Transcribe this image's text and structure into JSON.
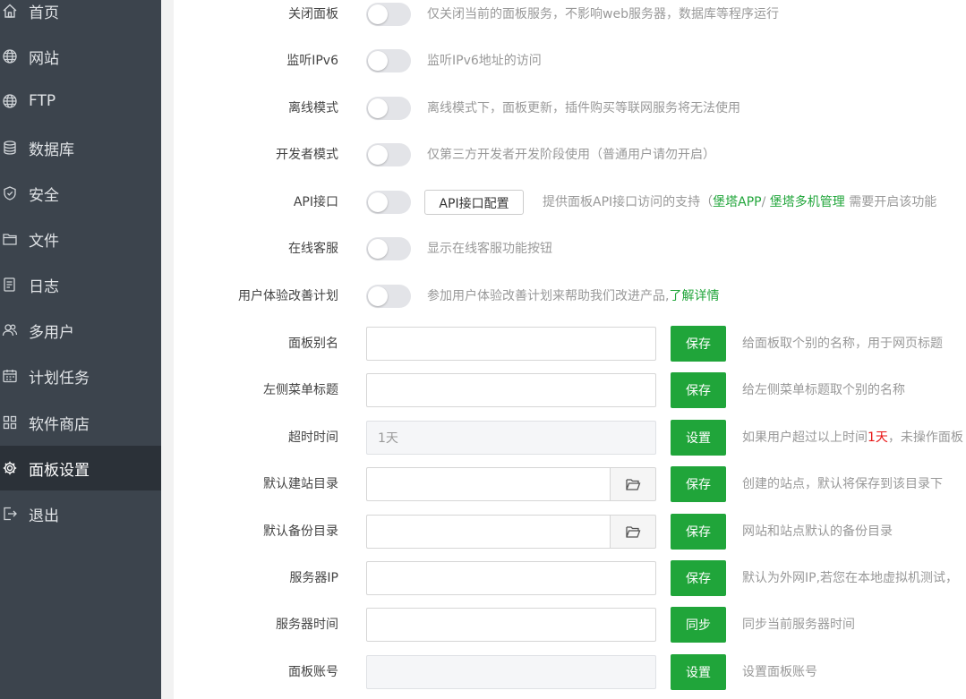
{
  "sidebar": {
    "items": [
      {
        "label": "首页",
        "icon": "home-icon"
      },
      {
        "label": "网站",
        "icon": "globe-icon"
      },
      {
        "label": "FTP",
        "icon": "ftp-globe-icon"
      },
      {
        "label": "数据库",
        "icon": "database-icon"
      },
      {
        "label": "安全",
        "icon": "shield-icon"
      },
      {
        "label": "文件",
        "icon": "folder-icon"
      },
      {
        "label": "日志",
        "icon": "log-icon"
      },
      {
        "label": "多用户",
        "icon": "users-icon"
      },
      {
        "label": "计划任务",
        "icon": "calendar-icon"
      },
      {
        "label": "软件商店",
        "icon": "grid-icon"
      },
      {
        "label": "面板设置",
        "icon": "gear-icon",
        "active": true
      },
      {
        "label": "退出",
        "icon": "logout-icon"
      }
    ]
  },
  "settings": {
    "close_panel": {
      "label": "关闭面板",
      "desc": "仅关闭当前的面板服务，不影响web服务器，数据库等程序运行"
    },
    "ipv6": {
      "label": "监听IPv6",
      "desc": "监听IPv6地址的访问"
    },
    "offline": {
      "label": "离线模式",
      "desc": "离线模式下，面板更新，插件购买等联网服务将无法使用"
    },
    "developer": {
      "label": "开发者模式",
      "desc": "仅第三方开发者开发阶段使用（普通用户请勿开启）"
    },
    "api": {
      "label": "API接口",
      "config_button": "API接口配置",
      "desc_prefix": "提供面板API接口访问的支持（",
      "link_app": "堡塔APP",
      "sep": "/",
      "link_multi": "堡塔多机管理",
      "desc_suffix": " 需要开启该功能"
    },
    "online_service": {
      "label": "在线客服",
      "desc": "显示在线客服功能按钮"
    },
    "ux_plan": {
      "label": "用户体验改善计划",
      "desc": "参加用户体验改善计划来帮助我们改进产品,",
      "link": "了解详情"
    },
    "panel_alias": {
      "label": "面板别名",
      "value": "",
      "button": "保存",
      "desc": "给面板取个别的名称，用于网页标题"
    },
    "menu_title": {
      "label": "左侧菜单标题",
      "value": "",
      "button": "保存",
      "desc": "给左侧菜单标题取个别的名称"
    },
    "timeout": {
      "label": "超时时间",
      "value": "1天",
      "button": "设置",
      "desc_prefix": "如果用户超过以上时间",
      "desc_highlight": "1天",
      "desc_suffix": "，未操作面板"
    },
    "site_dir": {
      "label": "默认建站目录",
      "value": "",
      "button": "保存",
      "desc": "创建的站点，默认将保存到该目录下"
    },
    "backup_dir": {
      "label": "默认备份目录",
      "value": "",
      "button": "保存",
      "desc": "网站和站点默认的备份目录"
    },
    "server_ip": {
      "label": "服务器IP",
      "value": "",
      "button": "保存",
      "desc": "默认为外网IP,若您在本地虚拟机测试，"
    },
    "server_time": {
      "label": "服务器时间",
      "value": "",
      "button": "同步",
      "desc": "同步当前服务器时间"
    },
    "panel_account": {
      "label": "面板账号",
      "value": "",
      "button": "设置",
      "desc": "设置面板账号"
    }
  }
}
